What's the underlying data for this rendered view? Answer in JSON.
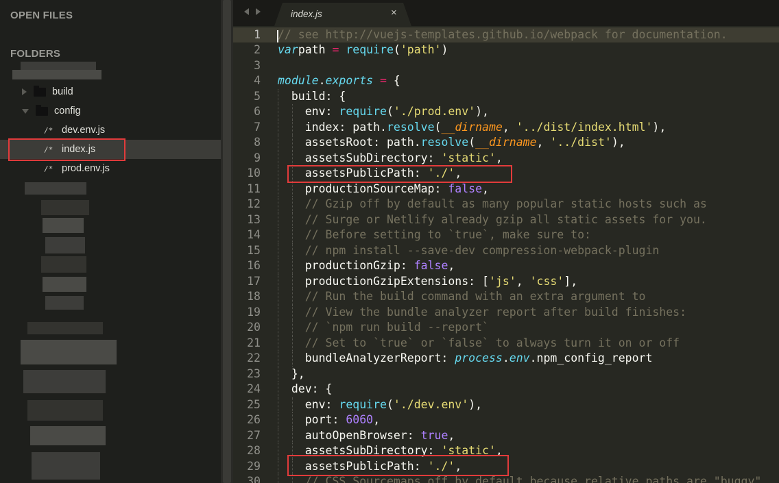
{
  "sidebar": {
    "open_files_label": "OPEN FILES",
    "folders_label": "FOLDERS",
    "items": [
      {
        "label": "build",
        "type": "folder",
        "expanded": false
      },
      {
        "label": "config",
        "type": "folder",
        "expanded": true
      },
      {
        "label": "dev.env.js",
        "type": "file",
        "icon": "/*"
      },
      {
        "label": "index.js",
        "type": "file",
        "icon": "/*",
        "active": true
      },
      {
        "label": "prod.env.js",
        "type": "file",
        "icon": "/*"
      }
    ]
  },
  "tab": {
    "label": "index.js",
    "close_glyph": "×"
  },
  "colors": {
    "background": "#272822",
    "sidebar": "#1e1f1c",
    "highlight_box": "#e23b3b",
    "comment": "#75715e",
    "keyword": "#66d9ef",
    "operator": "#f92672",
    "string": "#e6db74",
    "number": "#ae81ff"
  },
  "editor": {
    "current_line": 1,
    "highlighted_lines": [
      10,
      29
    ],
    "lines": [
      {
        "n": 1,
        "indent": 0,
        "tokens": [
          [
            "com",
            "// see http://vuejs-templates.github.io/webpack for documentation."
          ]
        ]
      },
      {
        "n": 2,
        "indent": 0,
        "tokens": [
          [
            "kw",
            "var"
          ],
          [
            "",
            "path "
          ],
          [
            "op",
            "="
          ],
          [
            "",
            ""
          ],
          [
            "fn",
            "require"
          ],
          [
            "",
            "("
          ],
          [
            "str",
            "'path'"
          ],
          [
            "",
            ")"
          ]
        ]
      },
      {
        "n": 3,
        "indent": 0,
        "tokens": []
      },
      {
        "n": 4,
        "indent": 0,
        "tokens": [
          [
            "it",
            "module"
          ],
          [
            "",
            "."
          ],
          [
            "it",
            "exports"
          ],
          [
            "",
            " "
          ],
          [
            "op",
            "="
          ],
          [
            "",
            " {"
          ]
        ]
      },
      {
        "n": 5,
        "indent": 1,
        "tokens": [
          [
            "",
            "build: {"
          ]
        ]
      },
      {
        "n": 6,
        "indent": 2,
        "tokens": [
          [
            "",
            "env: "
          ],
          [
            "fn",
            "require"
          ],
          [
            "",
            "("
          ],
          [
            "str",
            "'./prod.env'"
          ],
          [
            "",
            "),"
          ]
        ]
      },
      {
        "n": 7,
        "indent": 2,
        "tokens": [
          [
            "",
            "index: path."
          ],
          [
            "fn",
            "resolve"
          ],
          [
            "",
            "("
          ],
          [
            "var",
            "__dirname"
          ],
          [
            "",
            ", "
          ],
          [
            "str",
            "'../dist/index.html'"
          ],
          [
            "",
            "),"
          ]
        ]
      },
      {
        "n": 8,
        "indent": 2,
        "tokens": [
          [
            "",
            "assetsRoot: path."
          ],
          [
            "fn",
            "resolve"
          ],
          [
            "",
            "("
          ],
          [
            "var",
            "__dirname"
          ],
          [
            "",
            ", "
          ],
          [
            "str",
            "'../dist'"
          ],
          [
            "",
            "),"
          ]
        ]
      },
      {
        "n": 9,
        "indent": 2,
        "tokens": [
          [
            "",
            "assetsSubDirectory: "
          ],
          [
            "str",
            "'static'"
          ],
          [
            "",
            ","
          ]
        ]
      },
      {
        "n": 10,
        "indent": 2,
        "tokens": [
          [
            "",
            "assetsPublicPath: "
          ],
          [
            "str",
            "'./'"
          ],
          [
            "",
            ","
          ]
        ]
      },
      {
        "n": 11,
        "indent": 2,
        "tokens": [
          [
            "",
            "productionSourceMap: "
          ],
          [
            "num",
            "false"
          ],
          [
            "",
            ","
          ]
        ]
      },
      {
        "n": 12,
        "indent": 2,
        "tokens": [
          [
            "com",
            "// Gzip off by default as many popular static hosts such as"
          ]
        ]
      },
      {
        "n": 13,
        "indent": 2,
        "tokens": [
          [
            "com",
            "// Surge or Netlify already gzip all static assets for you."
          ]
        ]
      },
      {
        "n": 14,
        "indent": 2,
        "tokens": [
          [
            "com",
            "// Before setting to `true`, make sure to:"
          ]
        ]
      },
      {
        "n": 15,
        "indent": 2,
        "tokens": [
          [
            "com",
            "// npm install --save-dev compression-webpack-plugin"
          ]
        ]
      },
      {
        "n": 16,
        "indent": 2,
        "tokens": [
          [
            "",
            "productionGzip: "
          ],
          [
            "num",
            "false"
          ],
          [
            "",
            ","
          ]
        ]
      },
      {
        "n": 17,
        "indent": 2,
        "tokens": [
          [
            "",
            "productionGzipExtensions: ["
          ],
          [
            "str",
            "'js'"
          ],
          [
            "",
            ", "
          ],
          [
            "str",
            "'css'"
          ],
          [
            "",
            "],"
          ]
        ]
      },
      {
        "n": 18,
        "indent": 2,
        "tokens": [
          [
            "com",
            "// Run the build command with an extra argument to"
          ]
        ]
      },
      {
        "n": 19,
        "indent": 2,
        "tokens": [
          [
            "com",
            "// View the bundle analyzer report after build finishes:"
          ]
        ]
      },
      {
        "n": 20,
        "indent": 2,
        "tokens": [
          [
            "com",
            "// `npm run build --report`"
          ]
        ]
      },
      {
        "n": 21,
        "indent": 2,
        "tokens": [
          [
            "com",
            "// Set to `true` or `false` to always turn it on or off"
          ]
        ]
      },
      {
        "n": 22,
        "indent": 2,
        "tokens": [
          [
            "",
            "bundleAnalyzerReport: "
          ],
          [
            "it",
            "process"
          ],
          [
            "",
            "."
          ],
          [
            "it",
            "env"
          ],
          [
            "",
            ".npm_config_report"
          ]
        ]
      },
      {
        "n": 23,
        "indent": 1,
        "tokens": [
          [
            "",
            "},"
          ]
        ]
      },
      {
        "n": 24,
        "indent": 1,
        "tokens": [
          [
            "",
            "dev: {"
          ]
        ]
      },
      {
        "n": 25,
        "indent": 2,
        "tokens": [
          [
            "",
            "env: "
          ],
          [
            "fn",
            "require"
          ],
          [
            "",
            "("
          ],
          [
            "str",
            "'./dev.env'"
          ],
          [
            "",
            "),"
          ]
        ]
      },
      {
        "n": 26,
        "indent": 2,
        "tokens": [
          [
            "",
            "port: "
          ],
          [
            "num",
            "6060"
          ],
          [
            "",
            ","
          ]
        ]
      },
      {
        "n": 27,
        "indent": 2,
        "tokens": [
          [
            "",
            "autoOpenBrowser: "
          ],
          [
            "num",
            "true"
          ],
          [
            "",
            ","
          ]
        ]
      },
      {
        "n": 28,
        "indent": 2,
        "tokens": [
          [
            "",
            "assetsSubDirectory: "
          ],
          [
            "str",
            "'static'"
          ],
          [
            "",
            ","
          ]
        ]
      },
      {
        "n": 29,
        "indent": 2,
        "tokens": [
          [
            "",
            "assetsPublicPath: "
          ],
          [
            "str",
            "'./'"
          ],
          [
            "",
            ","
          ]
        ]
      },
      {
        "n": 30,
        "indent": 2,
        "tokens": [
          [
            "com",
            "// CSS Sourcemaps off by default because relative paths are \"buggy\""
          ]
        ]
      }
    ]
  }
}
